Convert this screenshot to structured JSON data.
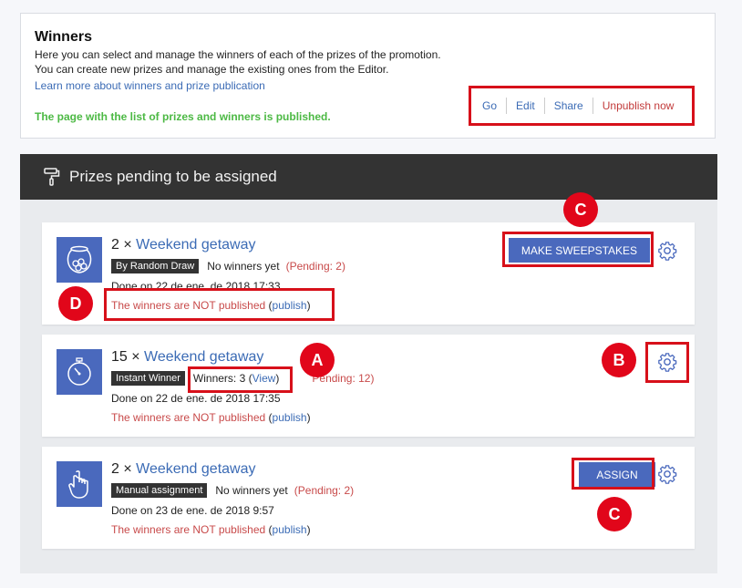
{
  "winners": {
    "title": "Winners",
    "desc_line1": "Here you can select and manage the winners of each of the prizes of the promotion.",
    "desc_line2": "You can create new prizes and manage the existing ones from the Editor.",
    "learn_more": "Learn more about winners and prize publication",
    "status": "The page with the list of prizes and winners is published.",
    "actions": [
      "Go",
      "Edit",
      "Share",
      "Unpublish now"
    ]
  },
  "panel": {
    "title": "Prizes pending to be assigned",
    "icon": "paint-roller-icon"
  },
  "prizes": [
    {
      "qty": "2 ×",
      "name": "Weekend getaway",
      "icon": "fishbowl-icon",
      "type": "By Random Draw",
      "winners": "No winners yet",
      "pending": "(Pending: 2)",
      "done": "Done on 22 de ene. de 2018 17:33",
      "not_published": "The winners are NOT published",
      "publish_open": "(",
      "publish": "publish",
      "publish_close": ")",
      "button": "MAKE SWEEPSTAKES"
    },
    {
      "qty": "15 ×",
      "name": "Weekend getaway",
      "icon": "stopwatch-icon",
      "type": "Instant Winner",
      "winners_label": "Winners: 3 (",
      "view": "View",
      "winners_close": ")",
      "pending": "Pending: 12)",
      "done": "Done on 22 de ene. de 2018 17:35",
      "not_published": "The winners are NOT published",
      "publish_open": "(",
      "publish": "publish",
      "publish_close": ")"
    },
    {
      "qty": "2 ×",
      "name": "Weekend getaway",
      "icon": "hand-pointer-icon",
      "type": "Manual assignment",
      "winners": "No winners yet",
      "pending": "(Pending: 2)",
      "done": "Done on 23 de ene. de 2018 9:57",
      "not_published": "The winners are NOT published",
      "publish_open": "(",
      "publish": "publish",
      "publish_close": ")",
      "button": "ASSIGN"
    }
  ],
  "callouts": {
    "a": "A",
    "b": "B",
    "c_top": "C",
    "c_bottom": "C",
    "d": "D"
  },
  "colors": {
    "accent": "#4a69bd",
    "link": "#3b6bb5",
    "published": "#4cb944",
    "warning": "#c84a4a",
    "highlight": "#d7101a"
  }
}
